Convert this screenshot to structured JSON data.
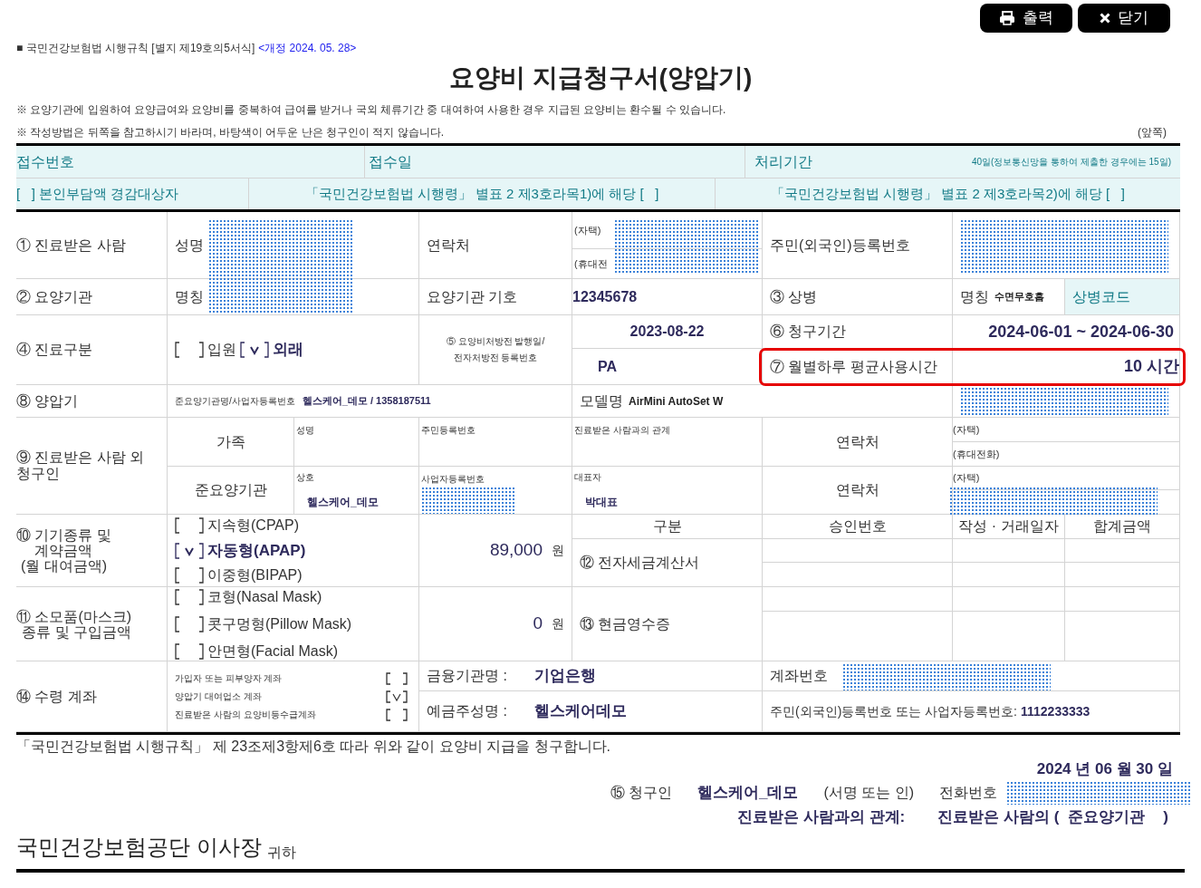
{
  "toolbar": [
    {
      "kind": "print",
      "label": "출력"
    },
    {
      "kind": "close",
      "label": "닫기"
    }
  ],
  "form_ref": "■ 국민건강보험법 시행규칙 [별지 제19호의5서식]",
  "revision": "<개정 2024. 05. 28>",
  "title": "요양비 지급청구서(양압기)",
  "notes": [
    "※ 요양기관에 입원하여 요양급여와 요양비를 중복하여 급여를 받거나 국외 체류기간 중 대여하여 사용한 경우 지급된 요양비는 환수될 수 있습니다.",
    "※ 작성방법은 뒤쪽을 참고하시기 바라며, 바탕색이 어두운 난은 청구인이 적지 않습니다."
  ],
  "page_side": "(앞쪽)",
  "office": {
    "receipt_number": "접수번호",
    "receipt_date": "접수일",
    "processing_label": "처리기간",
    "processing_period": "40일(정보통신망을 통하여 제출한 경우에는 15일)",
    "reduction": [
      "[   ] 본인부담액 경감대상자",
      "「국민건강보험법 시행령」 별표 2 제3호라목1)에 해당 [   ]",
      "「국민건강보험법 시행령」 별표 2 제3호라목2)에 해당 [   ]"
    ]
  },
  "patient": {
    "label": "① 진료받은 사람",
    "name_label": "성명",
    "contact_label": "연락처",
    "home": "(자택)",
    "mobile": "(휴대전",
    "id_label": "주민(외국인)등록번호"
  },
  "institution": {
    "label": "② 요양기관",
    "name_label": "명칭",
    "code_label": "요양기관 기호",
    "code": "12345678"
  },
  "disease": {
    "label": "③ 상병",
    "name_label": "명칭",
    "name": "수면무호흡",
    "code_label": "상병코드"
  },
  "care_type": {
    "label": "④ 진료구분",
    "options": [
      {
        "label": "입원",
        "checked": false
      },
      {
        "label": "외래",
        "checked": true
      }
    ]
  },
  "prescription": {
    "label": "⑤ 요양비처방전 발행일/\n전자처방전 등록번호",
    "date": "2023-08-22",
    "number": "PA"
  },
  "claim_period": {
    "label": "⑥ 청구기간",
    "value": "2024-06-01 ~ 2024-06-30"
  },
  "usage": {
    "label": "⑦ 월별하루 평균사용시간",
    "value": "10 시간",
    "highlighted": true
  },
  "device": {
    "label": "⑧ 양압기",
    "supplier_label": "준요양기관명/사업자등록번호",
    "supplier": "헬스케어_데모 / 1358187511",
    "model_label": "모델명",
    "model": "AirMini AutoSet W"
  },
  "other_claimant": {
    "label": "⑨ 진료받은 사람 외\n청구인",
    "family": {
      "label": "가족",
      "name_label": "성명",
      "id_label": "주민등록번호",
      "relation_label": "진료받은 사람과의 관계",
      "contact_label": "연락처",
      "home": "(자택)",
      "mobile": "(휴대전화)"
    },
    "provider": {
      "label": "준요양기관",
      "name_label": "상호",
      "name": "헬스케어_데모",
      "bizno_label": "사업자등록번호",
      "rep_label": "대표자",
      "rep": "박대표",
      "contact_label": "연락처",
      "home": "(자택)"
    }
  },
  "device_type": {
    "label": "⑩ 기기종류 및\n계약금액\n(월 대여금액)",
    "options": [
      {
        "label": "지속형(CPAP)",
        "checked": false
      },
      {
        "label": "자동형(APAP)",
        "checked": true
      },
      {
        "label": "이중형(BIPAP)",
        "checked": false
      }
    ],
    "amount": "89,000",
    "unit": "원"
  },
  "receipts": {
    "headers": [
      "구분",
      "승인번호",
      "작성 · 거래일자",
      "합계금액"
    ],
    "tax_invoice": "⑫ 전자세금계산서",
    "cash_receipt": "⑬ 현금영수증"
  },
  "supplies": {
    "label": "⑪ 소모품(마스크)\n종류 및 구입금액",
    "options": [
      {
        "label": "코형(Nasal Mask)",
        "checked": false
      },
      {
        "label": "콧구멍형(Pillow Mask)",
        "checked": false
      },
      {
        "label": "안면형(Facial Mask)",
        "checked": false
      }
    ],
    "amount": "0",
    "unit": "원"
  },
  "account": {
    "label": "⑭ 수령 계좌",
    "options": [
      {
        "label": "가입자 또는 피부양자 계좌",
        "checked": false
      },
      {
        "label": "양압기 대여업소 계좌",
        "checked": true
      },
      {
        "label": "진료받은 사람의 요양비등수급계좌",
        "checked": false
      }
    ],
    "bank_label": "금융기관명 :",
    "bank": "기업은행",
    "account_label": "계좌번호",
    "holder_label": "예금주성명 :",
    "holder": "헬스케어데모",
    "id_label": "주민(외국인)등록번호 또는 사업자등록번호:",
    "id": "1112233333"
  },
  "declaration": "「국민건강보험법 시행규칙」 제 23조제3항제6호 따라 위와 같이 요양비 지급을 청구합니다.",
  "date": "2024 년 06 월 30 일",
  "claimant": {
    "label": "⑮ 청구인",
    "name": "헬스케어_데모",
    "sign": "(서명 또는 인)",
    "phone_label": "전화번호",
    "relation_label": "진료받은 사람과의 관계:",
    "relation_prefix": "진료받은 사람의 (",
    "relation": "준요양기관",
    "relation_suffix": ")"
  },
  "recipient": {
    "name": "국민건강보험공단 이사장",
    "honorific": "귀하"
  }
}
